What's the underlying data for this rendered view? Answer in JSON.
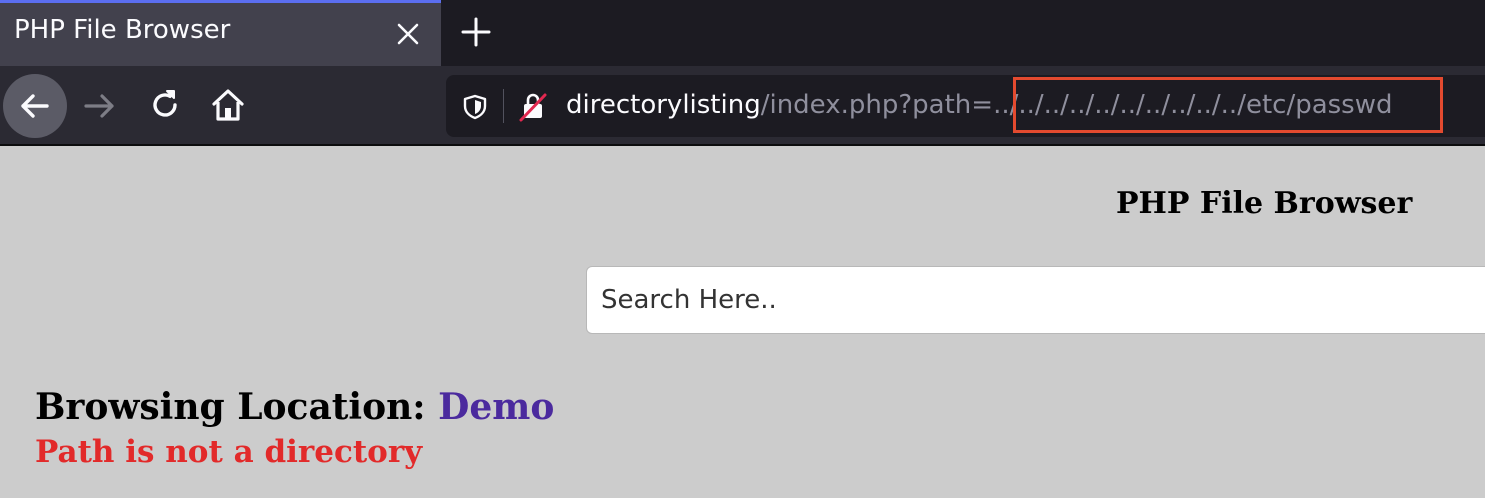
{
  "browser": {
    "tab": {
      "title": "PHP File Browser"
    },
    "url": {
      "host": "directorylisting",
      "path_prefix": "/index.php?path=",
      "path_param": "../../../../../../../../../../etc/passwd",
      "highlight_color": "#e34a2f"
    },
    "icons": {
      "close": "close-icon",
      "new_tab": "plus-icon",
      "back": "back-arrow-icon",
      "forward": "forward-arrow-icon",
      "reload": "reload-icon",
      "home": "home-icon",
      "shield": "shield-icon",
      "lock": "insecure-lock-icon"
    }
  },
  "page": {
    "title": "PHP File Browser",
    "search": {
      "placeholder": "Search Here.."
    },
    "browsing": {
      "label": "Browsing Location: ",
      "location": "Demo"
    },
    "error": "Path is not a directory",
    "colors": {
      "background": "#cccccc",
      "link": "#4b2a9e",
      "error": "#e22a2a"
    }
  }
}
